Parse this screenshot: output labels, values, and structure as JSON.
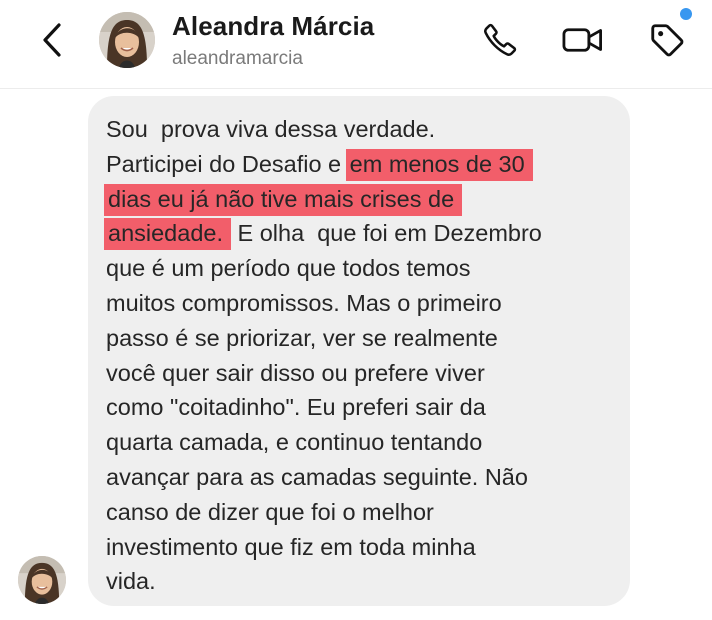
{
  "header": {
    "back_icon": "chevron-left-icon",
    "name": "Aleandra Márcia",
    "handle": "aleandramarcia",
    "call_icon": "phone-icon",
    "video_icon": "video-camera-icon",
    "tag_icon": "tag-icon",
    "notification_dot_color": "#3897f0"
  },
  "message": {
    "lines": [
      "Sou  prova viva dessa verdade.",
      "Participei do Desafio e ",
      "em menos de 30",
      "dias eu já não tive mais crises de",
      "ansiedade.",
      " E olha  que foi em Dezembro",
      "que é um período que todos temos",
      "muitos compromissos. Mas o primeiro",
      "passo é se priorizar, ver se realmente",
      "você quer sair disso ou prefere viver",
      "como \"coitadinho\". Eu preferi sair da",
      "quarta camada, e continuo tentando",
      "avançar para as camadas seguinte. Não",
      "canso de dizer que foi o melhor",
      "investimento que fiz em toda minha",
      "vida."
    ],
    "highlight_color": "#f25e6a",
    "bubble_color": "#efefef"
  }
}
